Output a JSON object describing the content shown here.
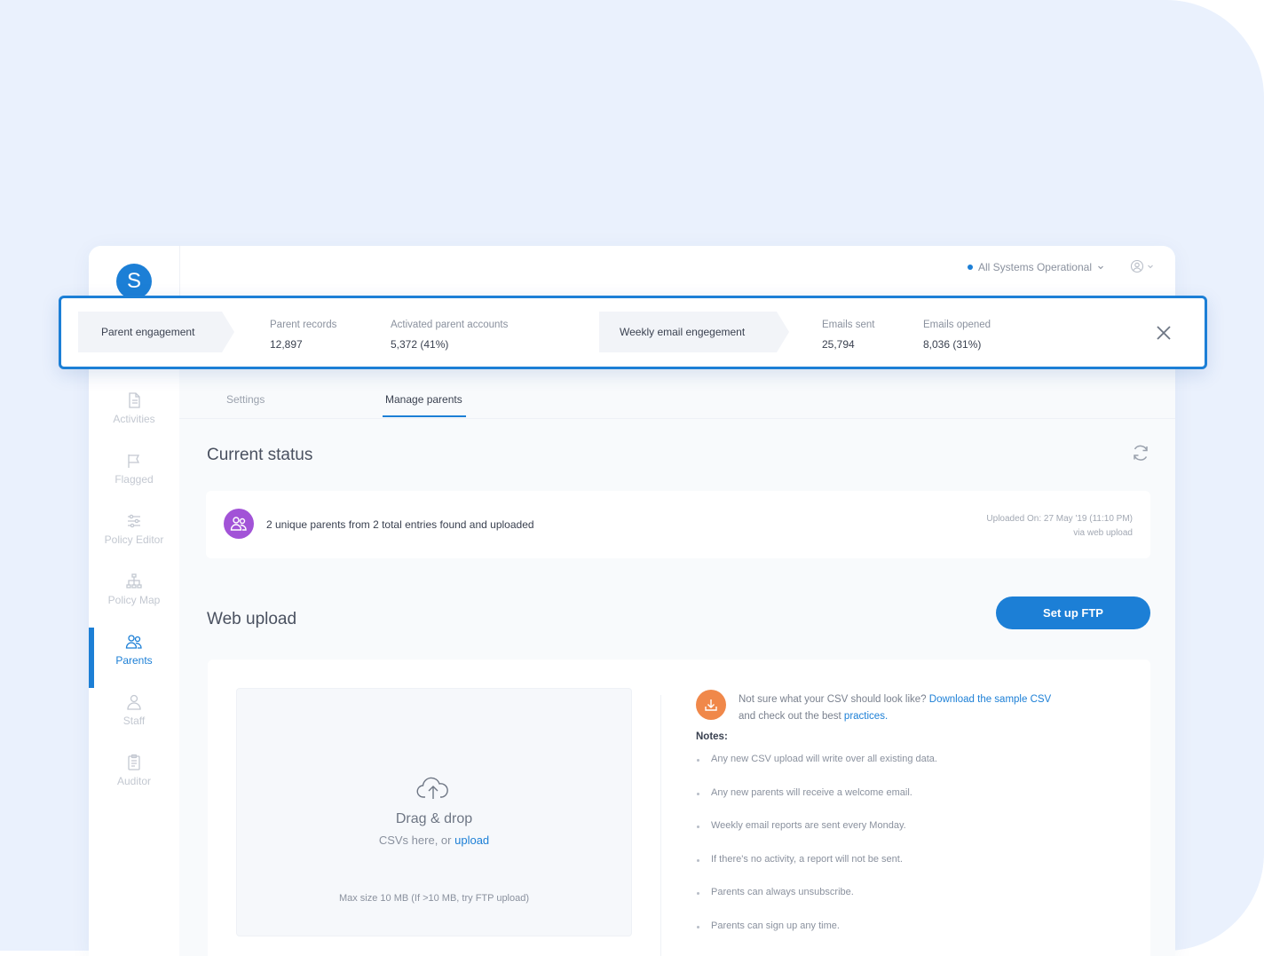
{
  "app": {
    "logo_letter": "S"
  },
  "topbar": {
    "status_text": "All Systems Operational"
  },
  "engagement_bar": {
    "parent_chip": "Parent engagement",
    "email_chip": "Weekly email engegement",
    "stats": [
      {
        "label": "Parent records",
        "value": "12,897"
      },
      {
        "label": "Activated parent accounts",
        "value": "5,372 (41%)"
      },
      {
        "label": "Emails sent",
        "value": "25,794"
      },
      {
        "label": "Emails opened",
        "value": "8,036 (31%)"
      }
    ]
  },
  "sidebar": {
    "items": [
      {
        "label": "Activities",
        "icon": "document-icon"
      },
      {
        "label": "Flagged",
        "icon": "flag-icon"
      },
      {
        "label": "Policy Editor",
        "icon": "sliders-icon"
      },
      {
        "label": "Policy Map",
        "icon": "hierarchy-icon"
      },
      {
        "label": "Parents",
        "icon": "parents-icon",
        "active": true
      },
      {
        "label": "Staff",
        "icon": "user-icon"
      },
      {
        "label": "Auditor",
        "icon": "clipboard-icon"
      }
    ]
  },
  "tabs": [
    {
      "label": "Settings",
      "active": false
    },
    {
      "label": "Manage parents",
      "active": true
    }
  ],
  "current_status": {
    "title": "Current status",
    "message": "2 unique parents from 2 total entries found and uploaded",
    "uploaded_on": "Uploaded On: 27 May '19 (11:10 PM)",
    "via": "via web upload"
  },
  "web_upload": {
    "title": "Web upload",
    "ftp_button": "Set up FTP",
    "drop_title": "Drag & drop",
    "drop_sub_prefix": "CSVs here, or",
    "drop_sub_link": "upload",
    "max_size": "Max size 10 MB (If >10 MB, try FTP upload)",
    "csv_prompt": "Not sure what your CSV should look like?",
    "csv_link": "Download the sample CSV",
    "csv_line2": "and check out the best",
    "csv_link2": "practices.",
    "notes_title": "Notes:",
    "notes": [
      "Any new CSV upload will write over all existing data.",
      "Any new parents will receive a welcome email.",
      "Weekly email reports are sent every Monday.",
      "If there's no activity, a report will not be sent.",
      "Parents can always unsubscribe.",
      "Parents can sign up any time."
    ]
  },
  "colors": {
    "accent": "#1c7fd6",
    "parents_badge": "#a253d7",
    "csv_badge": "#f0884a",
    "page_bg": "#eaf1fd"
  }
}
